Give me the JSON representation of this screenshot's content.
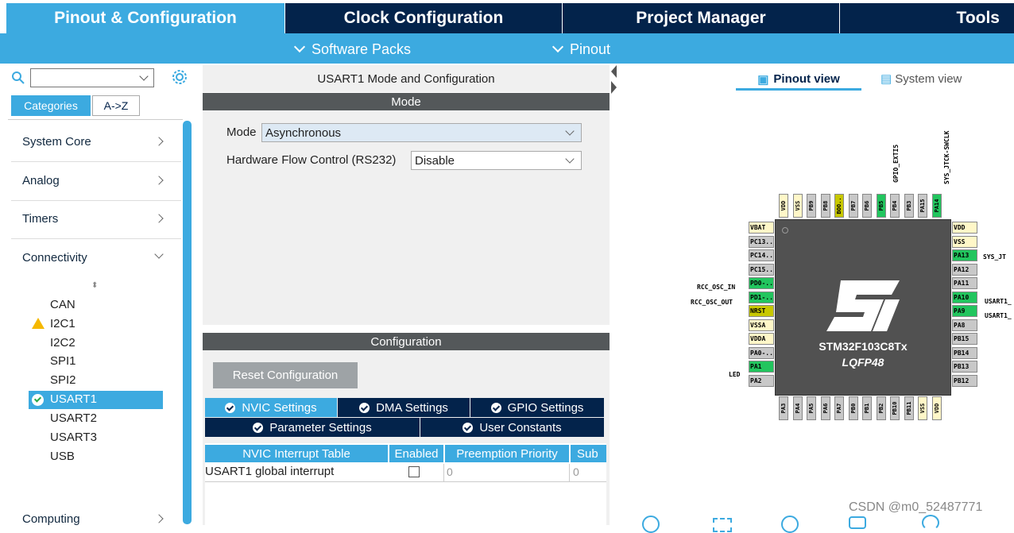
{
  "topnav": {
    "pinout": "Pinout & Configuration",
    "clock": "Clock Configuration",
    "project": "Project Manager",
    "tools": "Tools"
  },
  "subnav": {
    "software_packs": "Software Packs",
    "pinout": "Pinout"
  },
  "left": {
    "search_value": "",
    "tab_categories": "Categories",
    "tab_az": "A->Z",
    "categories": [
      {
        "label": "System Core"
      },
      {
        "label": "Analog"
      },
      {
        "label": "Timers"
      },
      {
        "label": "Connectivity"
      },
      {
        "label": "Computing"
      }
    ],
    "peripherals": [
      "CAN",
      "I2C1",
      "I2C2",
      "SPI1",
      "SPI2",
      "USART1",
      "USART2",
      "USART3",
      "USB"
    ],
    "selected_peripheral": "USART1"
  },
  "mid": {
    "title": "USART1 Mode and Configuration",
    "mode_header": "Mode",
    "mode_label": "Mode",
    "mode_value": "Asynchronous",
    "flow_label": "Hardware Flow Control (RS232)",
    "flow_value": "Disable",
    "config_header": "Configuration",
    "reset_button": "Reset Configuration",
    "tabs": {
      "nvic": "NVIC Settings",
      "dma": "DMA Settings",
      "gpio": "GPIO Settings",
      "param": "Parameter Settings",
      "user": "User Constants"
    },
    "table": {
      "headers": [
        "NVIC Interrupt Table",
        "Enabled",
        "Preemption Priority",
        "Sub"
      ],
      "rows": [
        {
          "name": "USART1 global interrupt",
          "enabled": false,
          "preemption": "0",
          "sub": "0"
        }
      ]
    }
  },
  "right": {
    "pinout_view": "Pinout view",
    "system_view": "System view",
    "chip_name": "STM32F103C8Tx",
    "chip_package": "LQFP48",
    "left_pins": [
      "VBAT",
      "PC13..",
      "PC14..",
      "PC15..",
      "PD0-..",
      "PD1-..",
      "NRST",
      "VSSA",
      "VDDA",
      "PA0-..",
      "PA1",
      "PA2"
    ],
    "right_pins": [
      "VDD",
      "VSS",
      "PA13",
      "PA12",
      "PA11",
      "PA10",
      "PA9",
      "PA8",
      "PB15",
      "PB14",
      "PB13",
      "PB12"
    ],
    "top_pins": [
      "VDD",
      "VSS",
      "PB9",
      "PB8",
      "BOO..",
      "PB7",
      "PB6",
      "PB5",
      "PB4",
      "PB3",
      "PA15",
      "PA14"
    ],
    "bottom_pins": [
      "PA3",
      "PA4",
      "PA5",
      "PA6",
      "PA7",
      "PB0",
      "PB1",
      "PB2",
      "PB10",
      "PB11",
      "VSS",
      "VDD"
    ],
    "signal_labels": {
      "osc_in": "RCC_OSC_IN",
      "osc_out": "RCC_OSC_OUT",
      "led": "LED",
      "sys_jt": "SYS_JT",
      "usart1_a": "USART1_",
      "usart1_b": "USART1_",
      "gpio_exti5": "GPIO_EXTI5",
      "sys_jtck": "SYS_JTCK-SWCLK"
    }
  },
  "watermark": "CSDN @m0_52487771",
  "colors": {
    "accent": "#3caae0",
    "dark": "#03234b",
    "pin_green": "#22c55e",
    "pin_yellow": "#c8c800",
    "pin_beige": "#fff7c8",
    "pin_gray": "#c8c8c8"
  }
}
